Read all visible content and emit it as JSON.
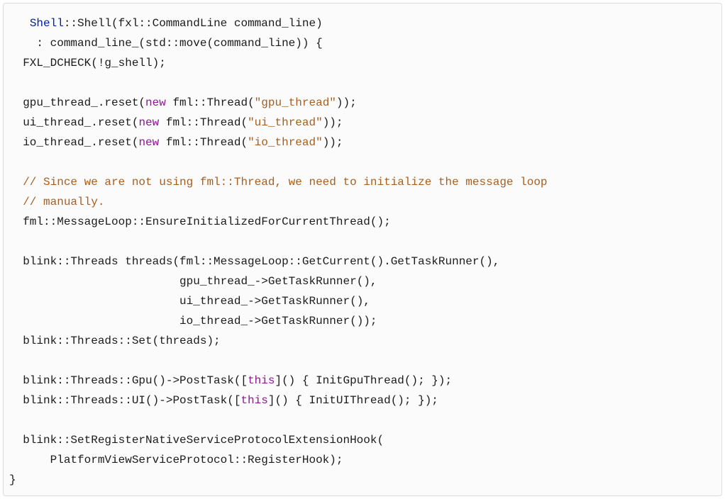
{
  "code": {
    "lines": [
      {
        "indent": "   ",
        "tokens": [
          {
            "cls": "tok-type",
            "text": "Shell"
          },
          {
            "cls": "",
            "text": "::Shell(fxl::CommandLine command_line)"
          }
        ]
      },
      {
        "indent": "    ",
        "tokens": [
          {
            "cls": "",
            "text": ": command_line_(std::move(command_line)) {"
          }
        ]
      },
      {
        "indent": "  ",
        "tokens": [
          {
            "cls": "",
            "text": "FXL_DCHECK(!g_shell);"
          }
        ]
      },
      {
        "indent": "",
        "tokens": [
          {
            "cls": "",
            "text": ""
          }
        ]
      },
      {
        "indent": "  ",
        "tokens": [
          {
            "cls": "",
            "text": "gpu_thread_.reset("
          },
          {
            "cls": "tok-keyword",
            "text": "new"
          },
          {
            "cls": "",
            "text": " fml::Thread("
          },
          {
            "cls": "tok-string",
            "text": "\"gpu_thread\""
          },
          {
            "cls": "",
            "text": "));"
          }
        ]
      },
      {
        "indent": "  ",
        "tokens": [
          {
            "cls": "",
            "text": "ui_thread_.reset("
          },
          {
            "cls": "tok-keyword",
            "text": "new"
          },
          {
            "cls": "",
            "text": " fml::Thread("
          },
          {
            "cls": "tok-string",
            "text": "\"ui_thread\""
          },
          {
            "cls": "",
            "text": "));"
          }
        ]
      },
      {
        "indent": "  ",
        "tokens": [
          {
            "cls": "",
            "text": "io_thread_.reset("
          },
          {
            "cls": "tok-keyword",
            "text": "new"
          },
          {
            "cls": "",
            "text": " fml::Thread("
          },
          {
            "cls": "tok-string",
            "text": "\"io_thread\""
          },
          {
            "cls": "",
            "text": "));"
          }
        ]
      },
      {
        "indent": "",
        "tokens": [
          {
            "cls": "",
            "text": ""
          }
        ]
      },
      {
        "indent": "  ",
        "tokens": [
          {
            "cls": "tok-comment",
            "text": "// Since we are not using fml::Thread, we need to initialize the message loop"
          }
        ]
      },
      {
        "indent": "  ",
        "tokens": [
          {
            "cls": "tok-comment",
            "text": "// manually."
          }
        ]
      },
      {
        "indent": "  ",
        "tokens": [
          {
            "cls": "",
            "text": "fml::MessageLoop::EnsureInitializedForCurrentThread();"
          }
        ]
      },
      {
        "indent": "",
        "tokens": [
          {
            "cls": "",
            "text": ""
          }
        ]
      },
      {
        "indent": "  ",
        "tokens": [
          {
            "cls": "",
            "text": "blink::Threads threads(fml::MessageLoop::GetCurrent().GetTaskRunner(),"
          }
        ]
      },
      {
        "indent": "                         ",
        "tokens": [
          {
            "cls": "",
            "text": "gpu_thread_->GetTaskRunner(),"
          }
        ]
      },
      {
        "indent": "                         ",
        "tokens": [
          {
            "cls": "",
            "text": "ui_thread_->GetTaskRunner(),"
          }
        ]
      },
      {
        "indent": "                         ",
        "tokens": [
          {
            "cls": "",
            "text": "io_thread_->GetTaskRunner());"
          }
        ]
      },
      {
        "indent": "  ",
        "tokens": [
          {
            "cls": "",
            "text": "blink::Threads::Set(threads);"
          }
        ]
      },
      {
        "indent": "",
        "tokens": [
          {
            "cls": "",
            "text": ""
          }
        ]
      },
      {
        "indent": "  ",
        "tokens": [
          {
            "cls": "",
            "text": "blink::Threads::Gpu()->PostTask(["
          },
          {
            "cls": "tok-lambda",
            "text": "this"
          },
          {
            "cls": "",
            "text": "]() { InitGpuThread(); });"
          }
        ]
      },
      {
        "indent": "  ",
        "tokens": [
          {
            "cls": "",
            "text": "blink::Threads::UI()->PostTask(["
          },
          {
            "cls": "tok-lambda",
            "text": "this"
          },
          {
            "cls": "",
            "text": "]() { InitUIThread(); });"
          }
        ]
      },
      {
        "indent": "",
        "tokens": [
          {
            "cls": "",
            "text": ""
          }
        ]
      },
      {
        "indent": "  ",
        "tokens": [
          {
            "cls": "",
            "text": "blink::SetRegisterNativeServiceProtocolExtensionHook("
          }
        ]
      },
      {
        "indent": "      ",
        "tokens": [
          {
            "cls": "",
            "text": "PlatformViewServiceProtocol::RegisterHook);"
          }
        ]
      },
      {
        "indent": "",
        "tokens": [
          {
            "cls": "",
            "text": "}"
          }
        ]
      }
    ]
  }
}
